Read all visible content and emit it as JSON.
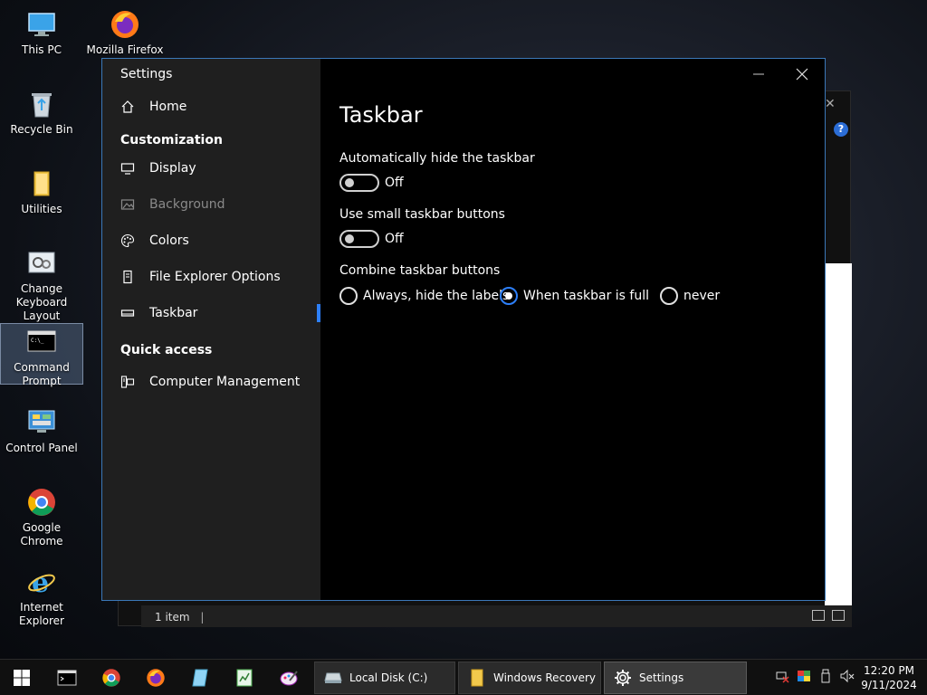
{
  "desktop": {
    "icons": [
      {
        "label": "This PC",
        "icon": "computer-icon"
      },
      {
        "label": "Mozilla Firefox",
        "icon": "firefox-icon"
      },
      {
        "label": "Recycle Bin",
        "icon": "recycle-bin-icon"
      },
      {
        "label": "Utilities",
        "icon": "folder-icon"
      },
      {
        "label": "Change Keyboard Layout",
        "icon": "keyboard-settings-icon"
      },
      {
        "label": "Command Prompt",
        "icon": "terminal-icon"
      },
      {
        "label": "Control Panel",
        "icon": "control-panel-icon"
      },
      {
        "label": "Google Chrome",
        "icon": "chrome-icon"
      },
      {
        "label": "Internet Explorer",
        "icon": "internet-explorer-icon"
      }
    ]
  },
  "background_window": {
    "status_text": "1 item",
    "help_label": "?"
  },
  "settings": {
    "title": "Settings",
    "home_label": "Home",
    "section_customization": "Customization",
    "nav": [
      {
        "label": "Display",
        "icon": "monitor-icon",
        "disabled": false
      },
      {
        "label": "Background",
        "icon": "image-icon",
        "disabled": true
      },
      {
        "label": "Colors",
        "icon": "palette-icon",
        "disabled": false
      },
      {
        "label": "File Explorer Options",
        "icon": "file-options-icon",
        "disabled": false
      },
      {
        "label": "Taskbar",
        "icon": "taskbar-icon",
        "disabled": false,
        "selected": true
      }
    ],
    "section_quick_access": "Quick access",
    "quick_access": [
      {
        "label": "Computer Management",
        "icon": "computer-management-icon"
      }
    ],
    "page": {
      "title": "Taskbar",
      "auto_hide_label": "Automatically hide the taskbar",
      "auto_hide_state": "Off",
      "small_buttons_label": "Use small taskbar buttons",
      "small_buttons_state": "Off",
      "combine_label": "Combine taskbar buttons",
      "combine_options": [
        {
          "label": "Always, hide the labels",
          "checked": false
        },
        {
          "label": "When taskbar is full",
          "checked": true
        },
        {
          "label": "never",
          "checked": false
        }
      ]
    },
    "accent_color": "#2d7ff9"
  },
  "taskbar": {
    "pinned": [
      "windows-start-icon",
      "terminal-icon",
      "chrome-icon",
      "firefox-icon",
      "notepad-icon",
      "spreadsheet-icon",
      "paint-icon"
    ],
    "tasks": [
      {
        "label": "Local Disk (C:)",
        "icon": "drive-icon"
      },
      {
        "label": "Windows Recovery",
        "icon": "folder-icon"
      },
      {
        "label": "Settings",
        "icon": "gear-icon",
        "active": true
      }
    ],
    "clock_time": "12:20 PM",
    "clock_date": "9/11/2024"
  }
}
